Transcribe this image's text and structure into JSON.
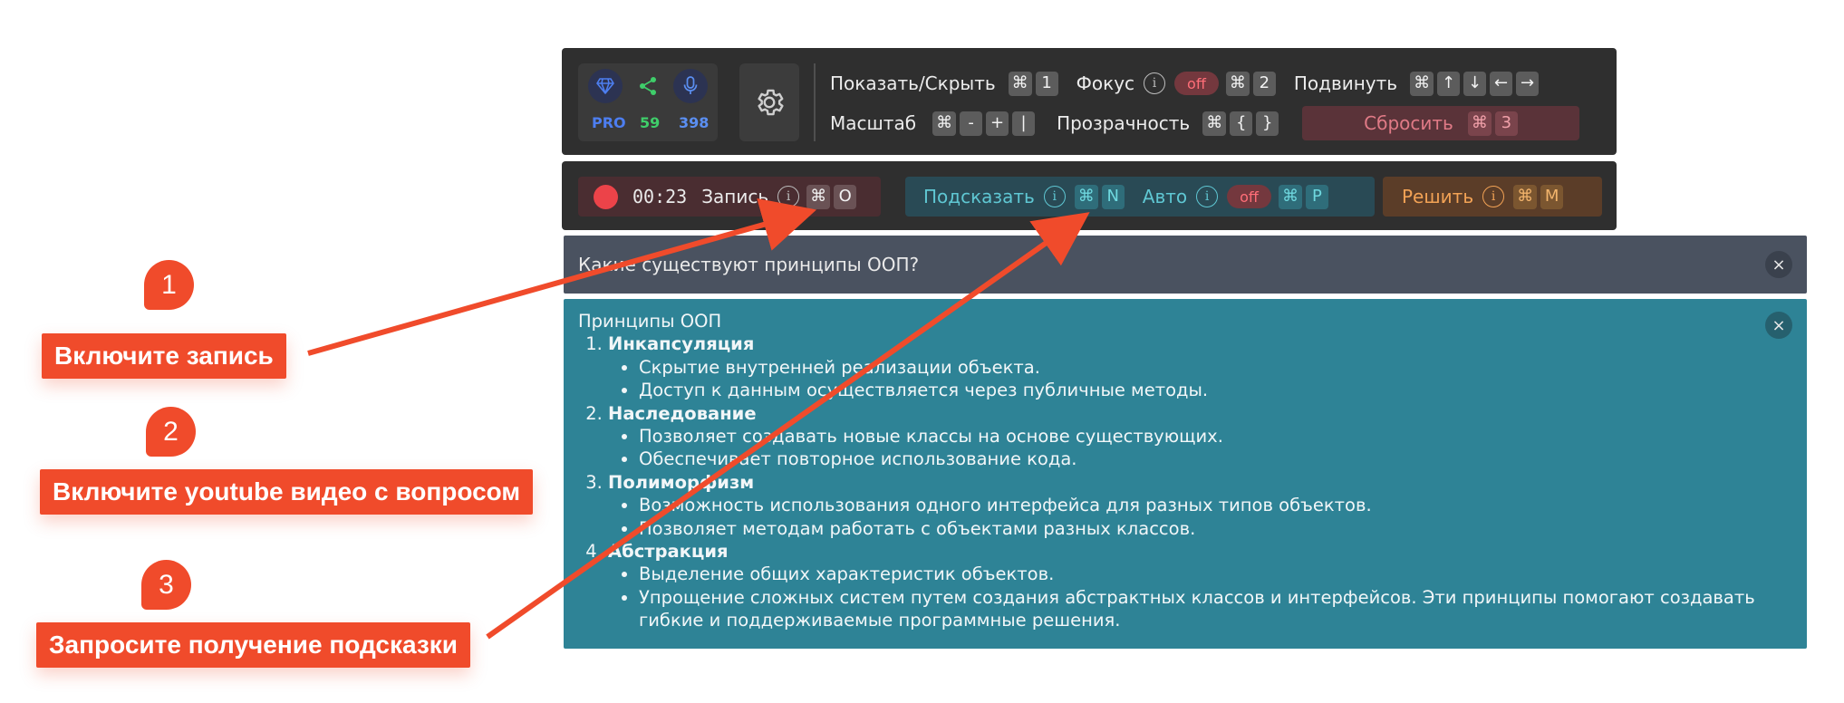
{
  "colors": {
    "accent_red": "#f04b2b",
    "toolbar_bg": "#2f2f2f",
    "answer_bg": "#2e8396",
    "question_bg": "#4a5260",
    "hint_text": "#5fc7d3",
    "solve_text": "#f2a255",
    "reset_text": "#e07a86"
  },
  "stats": {
    "pro_label": "PRO",
    "share_count": "59",
    "mic_count": "398",
    "icons": [
      "diamond-icon",
      "share-icon",
      "microphone-icon"
    ]
  },
  "toolbar": {
    "row1": {
      "show_hide": {
        "label": "Показать/Скрыть",
        "keys": [
          "⌘",
          "1"
        ]
      },
      "focus": {
        "label": "Фокус",
        "state": "off",
        "keys": [
          "⌘",
          "2"
        ]
      },
      "move": {
        "label": "Подвинуть",
        "keys": [
          "⌘",
          "↑",
          "↓",
          "←",
          "→"
        ]
      }
    },
    "row2": {
      "scale": {
        "label": "Масштаб",
        "keys": [
          "⌘",
          "-",
          "+",
          "|"
        ]
      },
      "opacity": {
        "label": "Прозрачность",
        "keys": [
          "⌘",
          "{",
          "}"
        ]
      },
      "reset": {
        "label": "Сбросить",
        "keys": [
          "⌘",
          "3"
        ]
      }
    }
  },
  "recbar": {
    "timer": "00:23",
    "record": {
      "label": "Запись",
      "keys": [
        "⌘",
        "O"
      ]
    },
    "hint": {
      "label": "Подсказать",
      "keys": [
        "⌘",
        "N"
      ]
    },
    "auto": {
      "label": "Авто",
      "state": "off",
      "keys": [
        "⌘",
        "P"
      ]
    },
    "solve": {
      "label": "Решить",
      "keys": [
        "⌘",
        "M"
      ]
    }
  },
  "question": {
    "text": "Какие существуют принципы ООП?",
    "close": "×"
  },
  "answer": {
    "title": "Принципы ООП",
    "close": "×",
    "items": [
      {
        "heading": "Инкапсуляция",
        "points": [
          "Скрытие внутренней реализации объекта.",
          "Доступ к данным осуществляется через публичные методы."
        ]
      },
      {
        "heading": "Наследование",
        "points": [
          "Позволяет создавать новые классы на основе существующих.",
          "Обеспечивает повторное использование кода."
        ]
      },
      {
        "heading": "Полиморфизм",
        "points": [
          "Возможность использования одного интерфейса для разных типов объектов.",
          "Позволяет методам работать с объектами разных классов."
        ]
      },
      {
        "heading": "Абстракция",
        "points": [
          "Выделение общих характеристик объектов.",
          "Упрощение сложных систем путем создания абстрактных классов и интерфейсов. Эти принципы помогают создавать гибкие и поддерживаемые программные решения."
        ]
      }
    ]
  },
  "callouts": [
    {
      "number": "1",
      "text": "Включите запись"
    },
    {
      "number": "2",
      "text": "Включите youtube видео с вопросом"
    },
    {
      "number": "3",
      "text": "Запросите получение подсказки"
    }
  ]
}
